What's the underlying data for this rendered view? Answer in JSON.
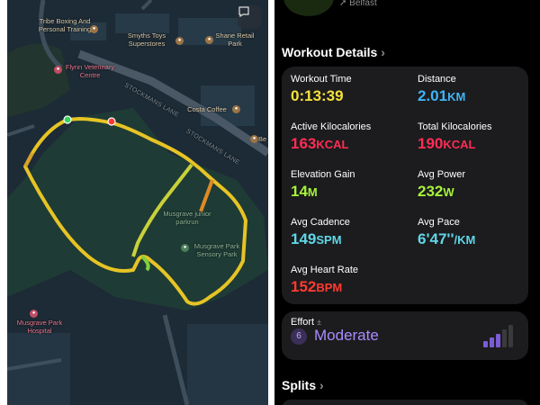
{
  "map": {
    "labels": {
      "tribe": "Tribe Boxing And Personal Training",
      "smyths": "Smyths Toys Superstores",
      "shane": "Shane Retail Park",
      "flynn": "Flynn Veterinary Centre",
      "costa": "Costa Coffee",
      "stock1": "STOCKMANS LANE",
      "stock2": "STOCKMANS LANE",
      "parkrun": "Musgrave junior parkrun",
      "sensory": "Musgrave Park Sensory Park",
      "hospital": "Musgrave Park Hospital",
      "be": "Be"
    },
    "icons": [
      "dumbbell-icon",
      "shopping-bag-icon",
      "paw-icon",
      "cup-icon",
      "tree-icon",
      "hospital-icon",
      "message-icon"
    ]
  },
  "workout": {
    "location": "Belfast",
    "details_title": "Workout Details",
    "metrics": [
      {
        "label": "Workout Time",
        "value": "0:13:39",
        "unit": "",
        "color": "#f5e13c"
      },
      {
        "label": "Distance",
        "value": "2.01",
        "unit": "KM",
        "color": "#3fb4f5"
      },
      {
        "label": "Active Kilocalories",
        "value": "163",
        "unit": "KCAL",
        "color": "#ff2d55"
      },
      {
        "label": "Total Kilocalories",
        "value": "190",
        "unit": "KCAL",
        "color": "#ff2d55"
      },
      {
        "label": "Elevation Gain",
        "value": "14",
        "unit": "M",
        "color": "#a6f23c"
      },
      {
        "label": "Avg Power",
        "value": "232",
        "unit": "W",
        "color": "#a6f23c"
      },
      {
        "label": "Avg Cadence",
        "value": "149",
        "unit": "SPM",
        "color": "#5fd7e8"
      },
      {
        "label": "Avg Pace",
        "value": "6'47''",
        "unit": "/KM",
        "color": "#5fd7e8"
      },
      {
        "label": "Avg Heart Rate",
        "value": "152",
        "unit": "BPM",
        "color": "#ff3b30"
      }
    ],
    "effort": {
      "label": "Effort",
      "number": "6",
      "level": "Moderate",
      "bar_fill": 0.6
    },
    "splits_title": "Splits"
  }
}
